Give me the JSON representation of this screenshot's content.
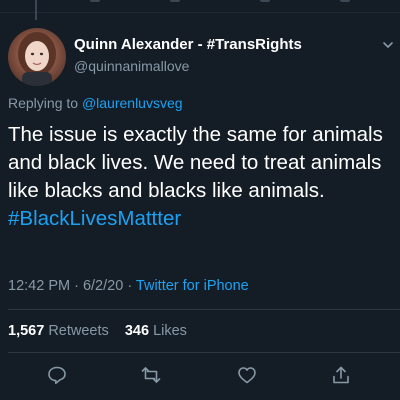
{
  "tweet": {
    "author": {
      "display_name": "Quinn Alexander - #TransRights",
      "handle": "@quinnanimallove"
    },
    "replying": {
      "prefix": "Replying to ",
      "target": "@laurenluvsveg"
    },
    "text": {
      "body": "The issue is exactly the same for animals and black lives. We need to treat animals like blacks and blacks like animals. ",
      "hashtag": "#BlackLivesMattter"
    },
    "meta": {
      "time": "12:42 PM",
      "separator1": " · ",
      "date": "6/2/20",
      "separator2": " · ",
      "source": "Twitter for iPhone"
    },
    "stats": {
      "retweets_count": "1,567",
      "retweets_label": "Retweets",
      "likes_count": "346",
      "likes_label": "Likes"
    },
    "actions": [
      "reply-icon",
      "retweet-icon",
      "like-icon",
      "share-icon"
    ]
  },
  "colors": {
    "background": "#141d26",
    "text": "#ffffff",
    "muted": "#8899a6",
    "link": "#1da1f2"
  }
}
